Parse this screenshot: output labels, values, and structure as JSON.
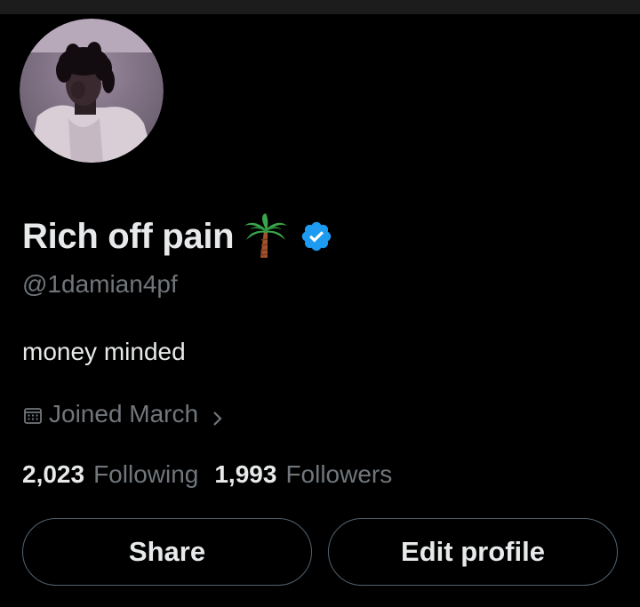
{
  "profile": {
    "display_name": "Rich off pain",
    "handle": "@1damian4pf",
    "bio": "money minded",
    "joined": "Joined March",
    "following_count": "2,023",
    "following_label": "Following",
    "followers_count": "1,993",
    "followers_label": "Followers",
    "verified": true
  },
  "icons": {
    "name_emoji": "palm-tree-icon",
    "badge": "verified-badge-icon",
    "joined": "calendar-icon",
    "joined_more": "chevron-right-icon"
  },
  "actions": {
    "share_label": "Share",
    "edit_label": "Edit profile"
  },
  "colors": {
    "background": "#000000",
    "primary_text": "#e7e9ea",
    "secondary_text": "#71767b",
    "verified_blue": "#1d9bf0",
    "button_border": "#536471"
  }
}
